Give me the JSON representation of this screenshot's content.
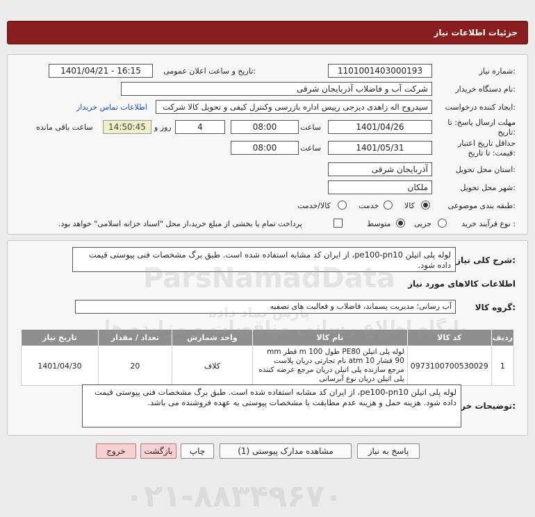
{
  "header": {
    "title": "جزئیات اطلاعات نیاز"
  },
  "form": {
    "need_number_label": "شماره نیاز:",
    "need_number": "1101001403000193",
    "announce_label": "تاریخ و ساعت اعلان عمومی:",
    "announce_value": "1401/04/21 - 16:15",
    "buyer_label": "نام دستگاه خریدار:",
    "buyer": "شرکت آب و فاضلاب آذربایجان شرقی",
    "requester_label": "ایجاد کننده درخواست:",
    "requester": "سیدروح اله زاهدی دیزجی رییس اداره بازرسی وکنترل کیفی و تحویل کالا شرکت",
    "contact_link": "اطلاعات تماس خریدار",
    "deadline_label_1": "مهلت ارسال پاسخ: تا",
    "deadline_label_2": "تاریخ:",
    "deadline_date": "1401/04/26",
    "time_label": "ساعت",
    "deadline_time": "08:00",
    "days_value": "4",
    "days_label": "روز و",
    "remaining_time": "14:50:45",
    "remaining_label": "ساعت باقی مانده",
    "validity_label_1": "حداقل تاریخ اعتبار",
    "validity_label_2": "قیمت: تا تاریخ:",
    "validity_date": "1401/05/31",
    "validity_time_label": "ساعت",
    "validity_time": "08:00",
    "province_label": "استان محل تحویل:",
    "province": "آذربایجان شرقی",
    "city_label": "شهر محل تحویل:",
    "city": "ملکان",
    "category_label": "طبقه بندی موضوعی:",
    "category_options": [
      "کالا",
      "خدمت",
      "کالا/خدمت"
    ],
    "purchase_label": "نوع فرآیند خرید :",
    "purchase_options": [
      "جزیی",
      "متوسط"
    ],
    "payment_note": "پرداخت تمام یا بخشی از مبلغ خرید،از محل \"اسناد خزانه اسلامی\" خواهد بود."
  },
  "summary": {
    "label": "شرح کلی نیاز:",
    "text": "لوله پلی اتیلن pe100-pn10، از ایران کد مشابه استفاده شده است. طبق برگ مشخصات فنی پیوستی قیمت داده شود."
  },
  "goods": {
    "section_title": "اطلاعات کالاهای مورد نیاز",
    "group_label": "گروه کالا:",
    "group_value": "آب رسانی؛ مدیریت پسماند، فاضلاب و فعالیت های تصفیه",
    "columns": [
      "ردیف",
      "کد کالا",
      "نام کالا",
      "واحد شمارش",
      "تعداد / مقدار",
      "تاریخ نیاز"
    ],
    "rows": [
      {
        "index": "1",
        "code": "0973100700530029",
        "name": "لوله پلی اتیلن PE80 طول m 100 قطر mm 90 فشار atm 10 نام تجارتی دریان پلاست مرجع سازنده پلی اتیلن دریان مرجع عرضه کننده پلی اتیلن دریان نوع آبرسانی",
        "unit": "کلاف",
        "qty": "20",
        "date": "1401/04/30"
      }
    ]
  },
  "buyer_notes": {
    "label": "توضیحات خریدار:",
    "text": "لوله پلی اتیلن pe100-pn10، از ایران کد مشابه استفاده شده است. طبق برگ مشخصات فنی پیوستی قیمت داده شود. هزینه حمل و هزینه عدم مطابقت با مشخصات پیوستی به عهده فروشنده می باشد."
  },
  "buttons": {
    "reply": "پاسخ به نیاز",
    "attachments": "مشاهده مدارک پیوستی (1)",
    "print": "چاپ",
    "back": "بازگشت",
    "exit": "خروج"
  },
  "watermark": {
    "brand": "ParsNamadData",
    "line1": "پایگاه اطلاع رسانی مناقصات و مزایده ها",
    "line2": "پارس نماد داده",
    "phone": "۰۲۱-۸۸۳۴۹۶۷۰"
  },
  "colors": {
    "header": "#8a1e1e",
    "table_header": "#8e8e8e",
    "link": "#1a4fb3"
  }
}
